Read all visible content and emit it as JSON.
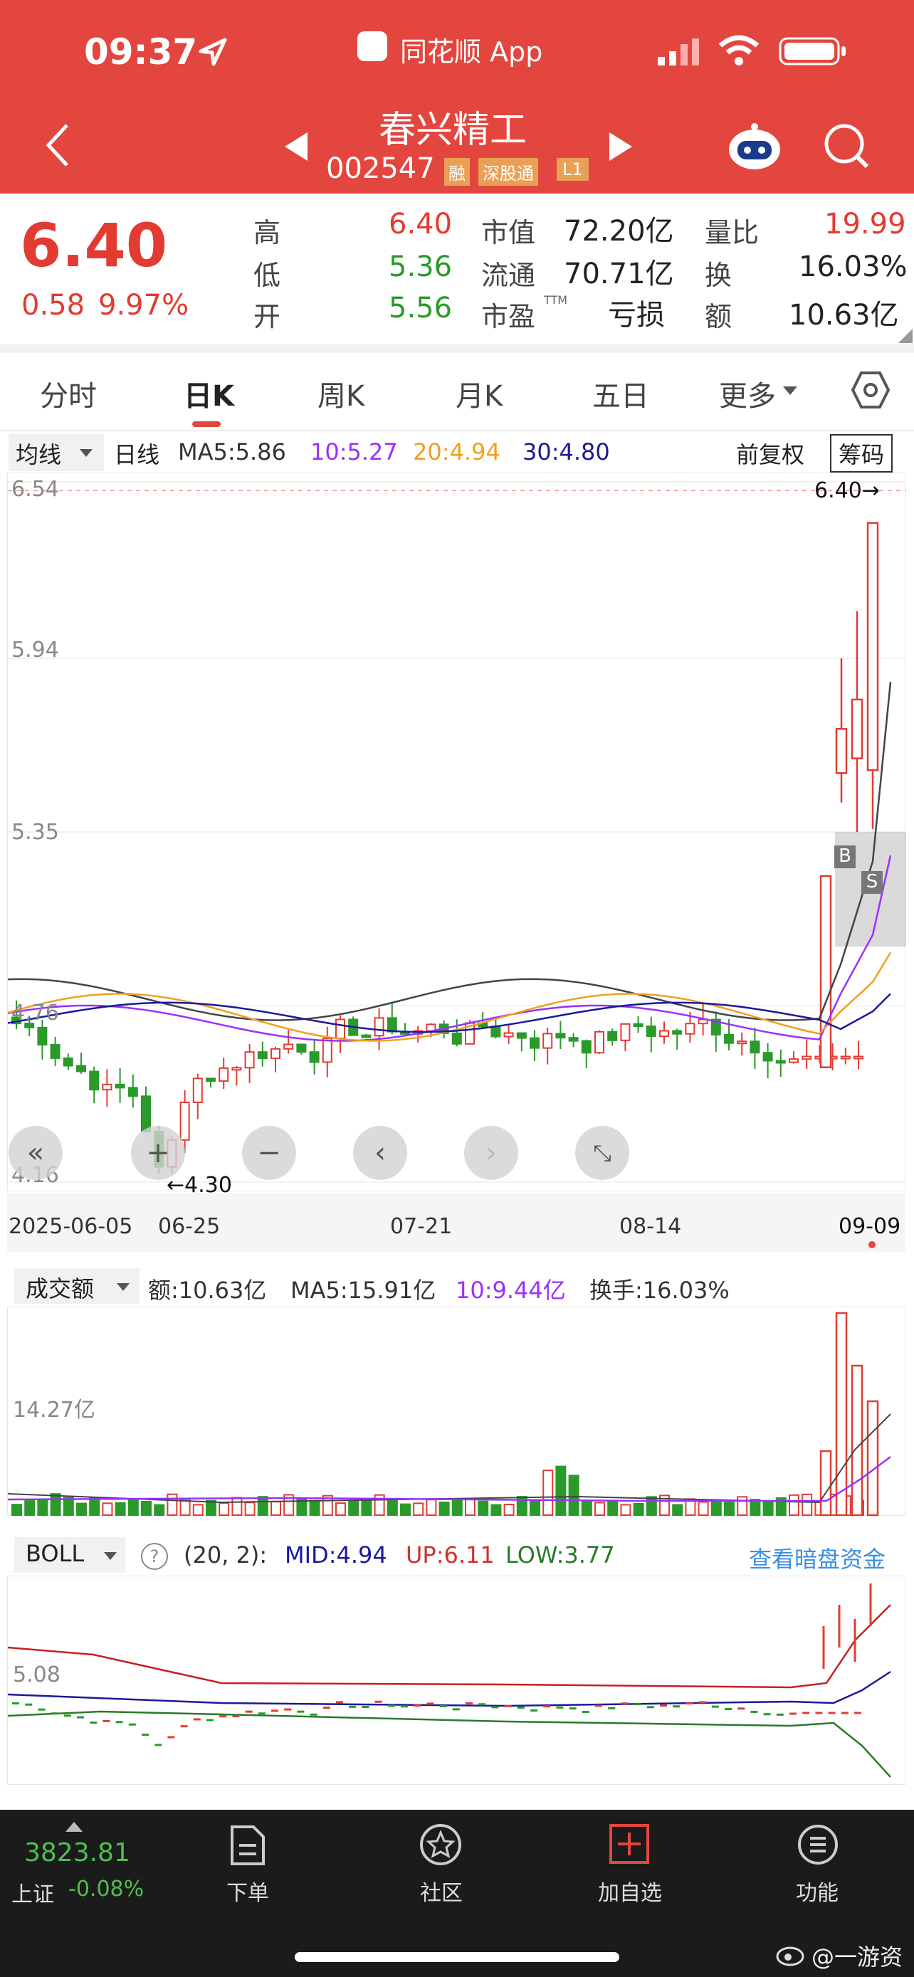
{
  "status": {
    "time": "09:37",
    "app_label": "同花顺 App"
  },
  "stock": {
    "name": "春兴精工",
    "code": "002547",
    "badge_rong": "融",
    "badge_sgt": "深股通",
    "badge_level": "L1"
  },
  "quote": {
    "price": "6.40",
    "change": "0.58",
    "change_pct": "9.97%",
    "high_label": "高",
    "high": "6.40",
    "low_label": "低",
    "low": "5.36",
    "open_label": "开",
    "open": "5.56",
    "mcap_label": "市值",
    "mcap": "72.20亿",
    "float_label": "流通",
    "float": "70.71亿",
    "pe_label": "市盈",
    "pe_sup": "TTM",
    "pe": "亏损",
    "vr_label": "量比",
    "vr": "19.99",
    "turn_label": "换",
    "turn": "16.03%",
    "amt_label": "额",
    "amt": "10.63亿"
  },
  "tabs": [
    "分时",
    "日K",
    "周K",
    "月K",
    "五日",
    "更多"
  ],
  "active_tab": "日K",
  "ma_bar": {
    "selector": "均线",
    "period": "日线",
    "ma5": "MA5:5.86",
    "ma10": "10:5.27",
    "ma20": "20:4.94",
    "ma30": "30:4.80",
    "adjust": "前复权",
    "chip": "筹码"
  },
  "price_chart": {
    "y_labels": [
      "6.54",
      "5.94",
      "5.35",
      "4.76",
      "4.16"
    ],
    "last_price_label": "6.40→",
    "low_marker": "←4.30",
    "x_labels": [
      "2025-06-05",
      "06-25",
      "07-21",
      "08-14",
      "09-09"
    ],
    "buy_mark": "B",
    "sell_mark": "S"
  },
  "volume_bar": {
    "selector": "成交额",
    "amount": "额:10.63亿",
    "ma5": "MA5:15.91亿",
    "ma10": "10:9.44亿",
    "turnover": "换手:16.03%",
    "y_label": "14.27亿"
  },
  "boll_bar": {
    "selector": "BOLL",
    "help": "?",
    "params": "(20, 2):",
    "mid": "MID:4.94",
    "up": "UP:6.11",
    "low": "LOW:3.77",
    "link": "查看暗盘资金",
    "y_label": "5.08"
  },
  "bottom_nav": {
    "index_value": "3823.81",
    "index_name": "上证",
    "index_change": "-0.08%",
    "items": [
      "下单",
      "社区",
      "加自选",
      "功能"
    ],
    "watermark": "@一游资"
  },
  "colors": {
    "header": "#e2463f",
    "up": "#e23b32",
    "down": "#2a9a2a",
    "ma5": "#444444",
    "ma10": "#9b30ff",
    "ma20": "#f0a020",
    "ma30": "#1a1a99"
  },
  "chart_data": {
    "type": "candlestick",
    "x_labels": [
      "2025-06-05",
      "06-25",
      "07-21",
      "08-14",
      "09-09"
    ],
    "ylim": [
      4.16,
      6.54
    ],
    "last_candles": [
      {
        "open": 4.55,
        "close": 5.2,
        "high": 5.2,
        "low": 4.55
      },
      {
        "open": 5.55,
        "close": 5.7,
        "high": 5.94,
        "low": 5.45
      },
      {
        "open": 5.8,
        "close": 5.6,
        "high": 6.1,
        "low": 5.35
      },
      {
        "open": 5.56,
        "close": 6.4,
        "high": 6.4,
        "low": 5.36
      }
    ]
  }
}
